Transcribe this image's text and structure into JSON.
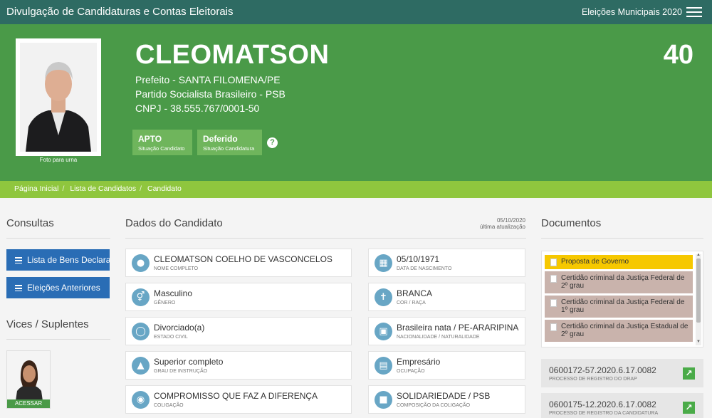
{
  "header": {
    "title": "Divulgação de Candidaturas e Contas Eleitorais",
    "election": "Eleições Municipais 2020"
  },
  "candidate": {
    "name": "CLEOMATSON",
    "number": "40",
    "office": "Prefeito - SANTA FILOMENA/PE",
    "party": "Partido Socialista Brasileiro - PSB",
    "cnpj": "CNPJ - 38.555.767/0001-50",
    "photo_caption": "Foto para urna",
    "badges": [
      {
        "value": "APTO",
        "label": "Situação Candidato"
      },
      {
        "value": "Deferido",
        "label": "Situação Candidatura"
      }
    ]
  },
  "breadcrumb": [
    "Página Inicial",
    "Lista de Candidatos",
    "Candidato"
  ],
  "left": {
    "consultas_title": "Consultas",
    "buttons": [
      "Lista de Bens Declarados",
      "Eleições Anteriores"
    ],
    "vices_title": "Vices / Suplentes",
    "vice_access": "ACESSAR"
  },
  "dados": {
    "title": "Dados do Candidato",
    "updated_date": "05/10/2020",
    "updated_label": "última atualização",
    "items": [
      {
        "value": "CLEOMATSON COELHO DE VASCONCELOS",
        "label": "Nome completo",
        "icon": "person-icon"
      },
      {
        "value": "05/10/1971",
        "label": "Data de nascimento",
        "icon": "calendar-icon"
      },
      {
        "value": "Masculino",
        "label": "Gênero",
        "icon": "gender-icon"
      },
      {
        "value": "BRANCA",
        "label": "Cor / Raça",
        "icon": "person-standing-icon"
      },
      {
        "value": "Divorciado(a)",
        "label": "Estado civil",
        "icon": "ring-icon"
      },
      {
        "value": "Brasileira nata / PE-ARARIPINA",
        "label": "Nacionalidade / Naturalidade",
        "icon": "map-icon"
      },
      {
        "value": "Superior completo",
        "label": "Grau de instrução",
        "icon": "graduation-cap-icon"
      },
      {
        "value": "Empresário",
        "label": "Ocupação",
        "icon": "building-icon"
      },
      {
        "value": "COMPROMISSO QUE FAZ A DIFERENÇA",
        "label": "Coligação",
        "icon": "group-icon"
      },
      {
        "value": "SOLIDARIEDADE / PSB",
        "label": "Composição da coligação",
        "icon": "folder-icon"
      }
    ]
  },
  "documentos": {
    "title": "Documentos",
    "items": [
      {
        "label": "Proposta de Governo",
        "color": "#f6c800"
      },
      {
        "label": "Certidão criminal da Justiça Federal de 2º grau",
        "color": "#c9b3ac"
      },
      {
        "label": "Certidão criminal da Justiça Federal de 1º grau",
        "color": "#c9b3ac"
      },
      {
        "label": "Certidão criminal da Justiça Estadual de 2º grau",
        "color": "#c9b3ac"
      }
    ],
    "processes": [
      {
        "number": "0600172-57.2020.6.17.0082",
        "label": "Processo de registro do DRAP"
      },
      {
        "number": "0600175-12.2020.6.17.0082",
        "label": "Processo de registro da candidatura"
      }
    ]
  },
  "colors": {
    "topbar": "#2e6b63",
    "hero": "#4a9a48",
    "breadcrumb": "#8fc63e",
    "button": "#2a6db5",
    "icon_circle": "#68a6c5"
  }
}
